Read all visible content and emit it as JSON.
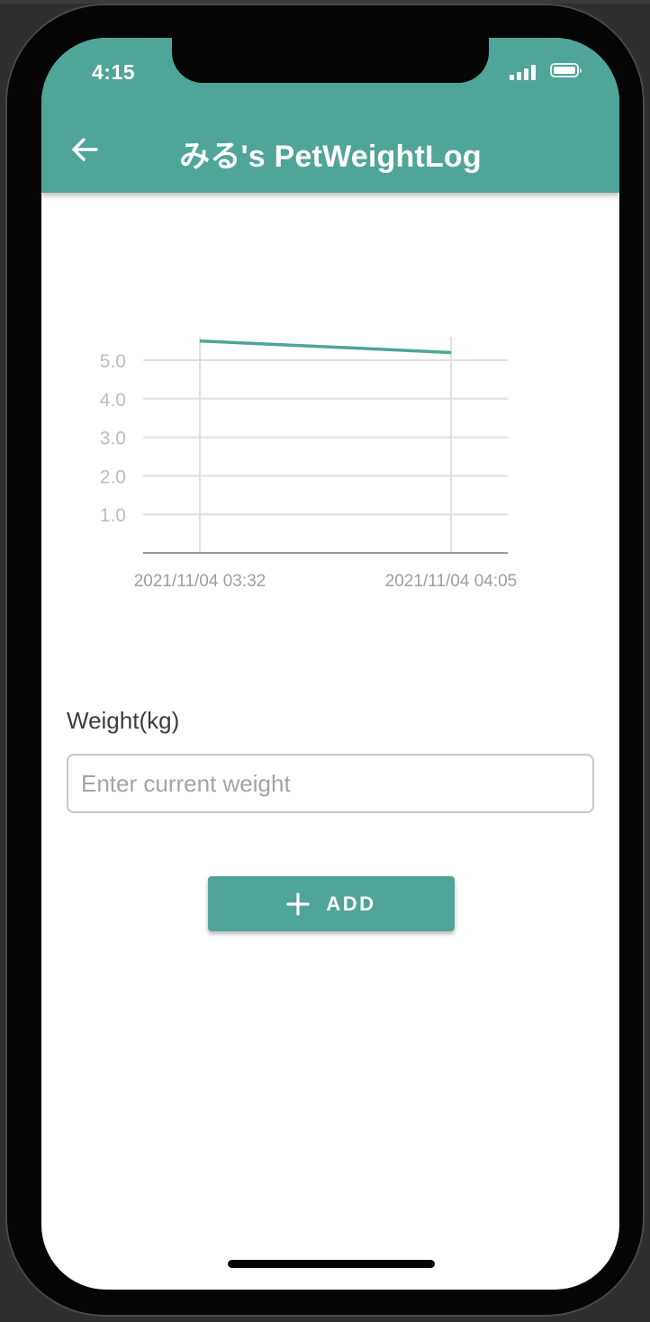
{
  "status_bar": {
    "time": "4:15"
  },
  "app_bar": {
    "title": "みる's PetWeightLog",
    "back_icon": "arrow-left-icon"
  },
  "chart_data": {
    "type": "line",
    "x": [
      "2021/11/04 03:32",
      "2021/11/04 04:05"
    ],
    "series": [
      {
        "values": [
          5.5,
          5.2
        ],
        "color": "#4fa597"
      }
    ],
    "y_ticks": [
      "1.0",
      "2.0",
      "3.0",
      "4.0",
      "5.0"
    ],
    "ylim": [
      0,
      5.0
    ],
    "grid": true,
    "title": "",
    "xlabel": "",
    "ylabel": ""
  },
  "form": {
    "weight_label": "Weight(kg)",
    "weight_value": "",
    "weight_placeholder": "Enter current weight",
    "add_label": "ADD",
    "add_icon": "plus-icon"
  },
  "colors": {
    "accent": "#4fa597",
    "grid": "#e0e0e0",
    "axis_text": "#bdbdbd",
    "date_text": "#9e9e9e"
  }
}
